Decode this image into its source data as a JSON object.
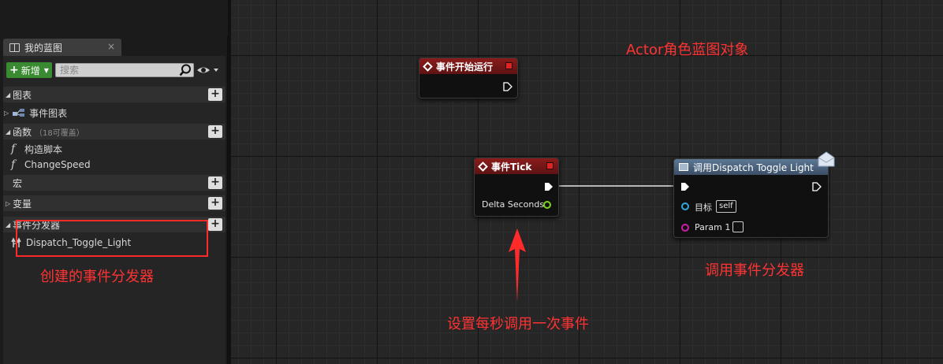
{
  "panel": {
    "tab_title": "我的蓝图",
    "tab_close": "×",
    "add_label": "新增",
    "search_placeholder": "搜索",
    "categories": {
      "graphs": "图表",
      "functions": "函数",
      "functions_sub": "（18可覆盖）",
      "macros": "宏",
      "variables": "变量",
      "dispatchers": "事件分发器"
    },
    "items": {
      "event_graph": "事件图表",
      "construction_script": "构造脚本",
      "change_speed": "ChangeSpeed",
      "dispatch_toggle_light": "Dispatch_Toggle_Light"
    }
  },
  "graph": {
    "node_begin_play": "事件开始运行",
    "node_tick": "事件Tick",
    "tick_pin": "Delta Seconds",
    "node_call": "调用Dispatch Toggle Light",
    "call_target_label": "目标",
    "call_target_value": "self",
    "call_param_label": "Param 1"
  },
  "annotations": {
    "actor": "Actor角色蓝图对象",
    "created": "创建的事件分发器",
    "call": "调用事件分发器",
    "tick": "设置每秒调用一次事件"
  },
  "colors": {
    "add_button": "#3a8a31",
    "event_header": "#8a1b1b",
    "function_header": "#5c7895",
    "float_pin": "#7ed321",
    "object_pin": "#2fa8e0",
    "param_pin": "#d01ca8",
    "annotation": "#ff3333"
  }
}
